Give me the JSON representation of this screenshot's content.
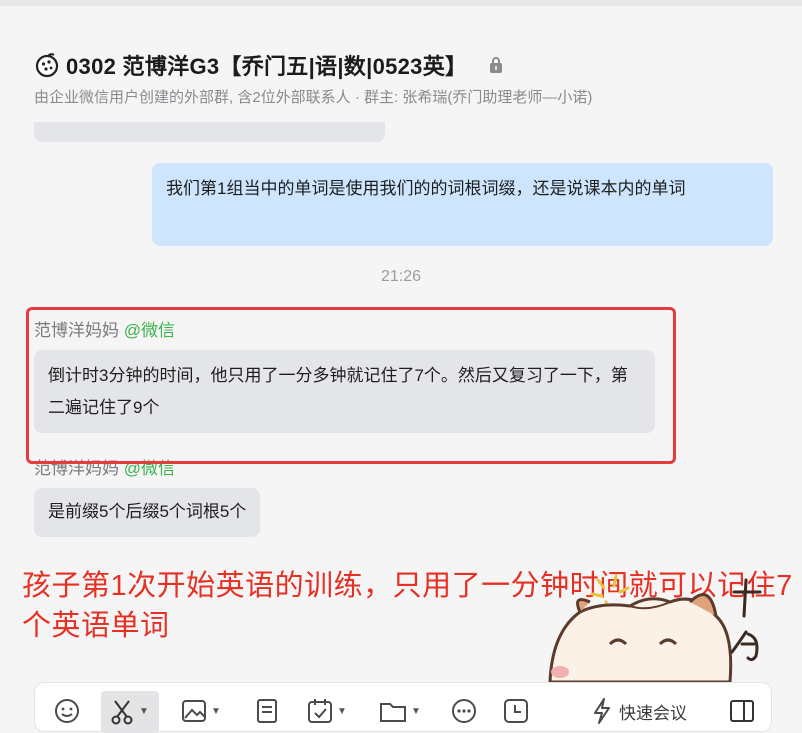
{
  "header": {
    "title": "0302 范博洋G3【乔门五|语|数|0523英】",
    "subtitle": "由企业微信用户创建的外部群, 含2位外部联系人 · 群主: 张希瑞(乔门助理老师—小诺)"
  },
  "messages": {
    "outgoing_1": "我们第1组当中的单词是使用我们的的词根词缀，还是说课本内的单词",
    "timestamp": "21:26",
    "sender_1_name": "范博洋妈妈",
    "sender_1_tag": "@微信",
    "incoming_1": "倒计时3分钟的时间，他只用了一分多钟就记住了7个。然后又复习了一下，第二遍记住了9个",
    "sender_2_name": "范博洋妈妈",
    "sender_2_tag": "@微信",
    "incoming_2": "是前缀5个后缀5个词根5个"
  },
  "annotation": {
    "caption": "孩子第1次开始英语的训练，只用了一分钟时间就可以记住7个英语单词",
    "color": "#e53023"
  },
  "toolbar": {
    "items": [
      "emoji-icon",
      "scissors-icon",
      "image-icon",
      "document-icon",
      "calendar-check-icon",
      "folder-icon",
      "more-icon",
      "clock-icon",
      "lightning-icon",
      "sidebar-icon"
    ],
    "quick_meeting_label": "快速会议"
  }
}
